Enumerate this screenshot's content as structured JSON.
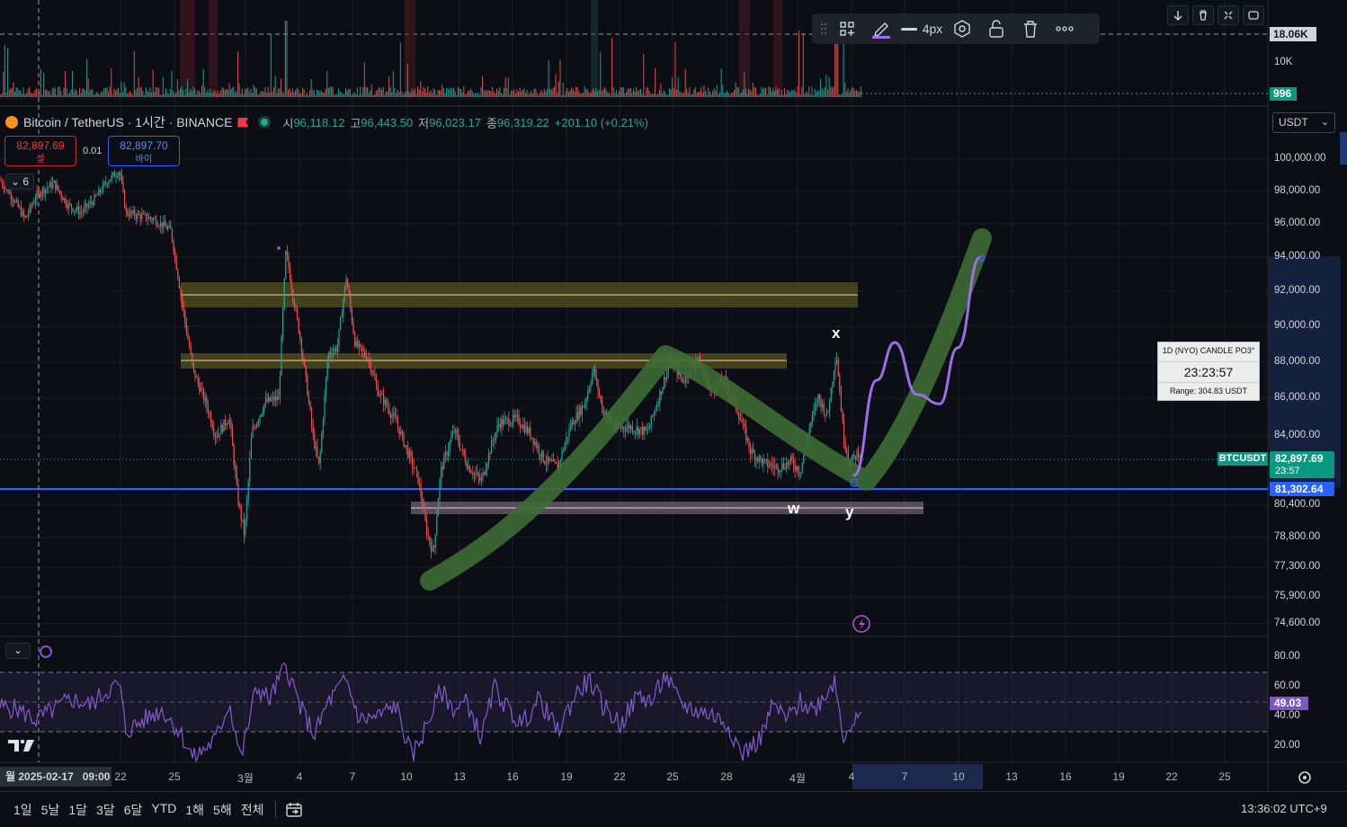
{
  "chart_title": {
    "symbol": "Bitcoin / TetherUS · 1시간 · BINANCE",
    "open_label": "시",
    "open": "96,118.12",
    "high_label": "고",
    "high": "96,443.50",
    "low_label": "저",
    "low": "96,023.17",
    "close_label": "종",
    "close": "96,319.22",
    "change": "+201.10 (+0.21%)"
  },
  "trade": {
    "sell_price": "82,897.69",
    "sell_label": "셀",
    "buy_price": "82,897.70",
    "buy_label": "바이",
    "lot": "0.01"
  },
  "collapse_count": "6",
  "toolbar": {
    "width_label": "4px"
  },
  "currency": "USDT",
  "price_axis": [
    "100,000.00",
    "98,000.00",
    "96,000.00",
    "94,000.00",
    "92,000.00",
    "90,000.00",
    "88,000.00",
    "86,000.00",
    "84,000.00",
    "80,400.00",
    "78,800.00",
    "77,300.00",
    "75,900.00",
    "74,600.00"
  ],
  "volume_axis": {
    "top": "18.06K",
    "mid": "10K",
    "current": "996"
  },
  "rsi_axis": [
    "80.00",
    "60.00",
    "40.00",
    "20.00"
  ],
  "rsi_current": "49.03",
  "tags": {
    "symbol": "BTCUSDT",
    "last_price": "82,897.69",
    "countdown": "23:57",
    "hline_price": "81,302.64"
  },
  "timer_widget": {
    "title": "1D (NYO) CANDLE PO3°",
    "time": "23:23:57",
    "range": "Range: 304.83 USDT"
  },
  "wave_labels": {
    "x": "x",
    "w": "w",
    "y": "y"
  },
  "x_axis": {
    "cursor_label": "월 2025-02-17   09:00",
    "labels": [
      "22",
      "25",
      "3월",
      "4",
      "7",
      "10",
      "13",
      "16",
      "19",
      "22",
      "25",
      "28",
      "4월",
      "4",
      "7",
      "10",
      "13",
      "16",
      "19",
      "22",
      "25"
    ]
  },
  "range_buttons": [
    "1일",
    "5날",
    "1달",
    "3달",
    "6달",
    "YTD",
    "1해",
    "5해",
    "전체"
  ],
  "clock": "13:36:02 UTC+9",
  "colors": {
    "bg": "#0c0e15",
    "up": "#26a69a",
    "down": "#ef5350",
    "hline": "#2962ff",
    "green_path": "#3e6b35",
    "purple": "#9c6fe4",
    "rsi": "#7e57c2"
  },
  "chart_data": {
    "type": "candlestick",
    "interval": "1시간",
    "ylim": [
      73800,
      101500
    ],
    "key_prices": {
      "hline": 81302.64,
      "resistance_zone_1": [
        91300,
        92600
      ],
      "resistance_zone_2": [
        87900,
        88600
      ],
      "support_zone": [
        80200,
        80700
      ],
      "last": 82897.69
    },
    "close_path": [
      [
        0,
        98700
      ],
      [
        12,
        97800
      ],
      [
        28,
        96300
      ],
      [
        40,
        97700
      ],
      [
        45,
        98000
      ],
      [
        60,
        98500
      ],
      [
        75,
        97200
      ],
      [
        90,
        96700
      ],
      [
        105,
        97500
      ],
      [
        120,
        98700
      ],
      [
        133,
        99300
      ],
      [
        140,
        96700
      ],
      [
        155,
        96500
      ],
      [
        170,
        96300
      ],
      [
        190,
        95600
      ],
      [
        205,
        90500
      ],
      [
        215,
        87500
      ],
      [
        230,
        85600
      ],
      [
        240,
        84000
      ],
      [
        255,
        85000
      ],
      [
        265,
        80600
      ],
      [
        272,
        78900
      ],
      [
        280,
        84200
      ],
      [
        295,
        85800
      ],
      [
        310,
        86000
      ],
      [
        318,
        94400
      ],
      [
        325,
        92000
      ],
      [
        335,
        89000
      ],
      [
        348,
        84000
      ],
      [
        355,
        82400
      ],
      [
        365,
        88500
      ],
      [
        375,
        88800
      ],
      [
        385,
        92800
      ],
      [
        395,
        89000
      ],
      [
        410,
        88200
      ],
      [
        420,
        86400
      ],
      [
        440,
        84800
      ],
      [
        455,
        83000
      ],
      [
        465,
        81800
      ],
      [
        475,
        79000
      ],
      [
        482,
        78000
      ],
      [
        490,
        82200
      ],
      [
        505,
        84300
      ],
      [
        520,
        82500
      ],
      [
        535,
        81700
      ],
      [
        545,
        83300
      ],
      [
        555,
        84700
      ],
      [
        575,
        84900
      ],
      [
        590,
        84100
      ],
      [
        605,
        82800
      ],
      [
        620,
        82400
      ],
      [
        635,
        84600
      ],
      [
        650,
        85700
      ],
      [
        660,
        87600
      ],
      [
        670,
        85400
      ],
      [
        685,
        84400
      ],
      [
        700,
        84500
      ],
      [
        720,
        84200
      ],
      [
        735,
        86400
      ],
      [
        745,
        88100
      ],
      [
        760,
        87000
      ],
      [
        775,
        88300
      ],
      [
        790,
        86400
      ],
      [
        805,
        87000
      ],
      [
        820,
        85400
      ],
      [
        835,
        83200
      ],
      [
        850,
        82600
      ],
      [
        865,
        82400
      ],
      [
        880,
        82700
      ],
      [
        890,
        82200
      ],
      [
        900,
        84400
      ],
      [
        910,
        86100
      ],
      [
        920,
        85000
      ],
      [
        930,
        88600
      ],
      [
        938,
        84000
      ],
      [
        945,
        82600
      ],
      [
        955,
        83200
      ],
      [
        958,
        82900
      ]
    ],
    "projection": [
      [
        950,
        82000
      ],
      [
        975,
        87000
      ],
      [
        995,
        89100
      ],
      [
        1020,
        86200
      ],
      [
        1045,
        85700
      ],
      [
        1065,
        88800
      ],
      [
        1090,
        94000
      ]
    ],
    "rsi_path": [
      [
        0,
        57
      ],
      [
        20,
        55
      ],
      [
        40,
        48
      ],
      [
        60,
        55
      ],
      [
        80,
        62
      ],
      [
        100,
        58
      ],
      [
        120,
        68
      ],
      [
        133,
        72
      ],
      [
        140,
        40
      ],
      [
        160,
        48
      ],
      [
        180,
        55
      ],
      [
        200,
        40
      ],
      [
        215,
        22
      ],
      [
        240,
        35
      ],
      [
        255,
        60
      ],
      [
        268,
        22
      ],
      [
        285,
        70
      ],
      [
        300,
        62
      ],
      [
        318,
        85
      ],
      [
        335,
        55
      ],
      [
        350,
        38
      ],
      [
        365,
        60
      ],
      [
        385,
        75
      ],
      [
        400,
        48
      ],
      [
        420,
        50
      ],
      [
        440,
        58
      ],
      [
        458,
        23
      ],
      [
        475,
        45
      ],
      [
        490,
        68
      ],
      [
        505,
        55
      ],
      [
        520,
        60
      ],
      [
        535,
        35
      ],
      [
        550,
        70
      ],
      [
        565,
        55
      ],
      [
        580,
        45
      ],
      [
        600,
        62
      ],
      [
        620,
        40
      ],
      [
        640,
        65
      ],
      [
        655,
        75
      ],
      [
        670,
        58
      ],
      [
        690,
        45
      ],
      [
        710,
        65
      ],
      [
        725,
        60
      ],
      [
        740,
        78
      ],
      [
        755,
        60
      ],
      [
        770,
        55
      ],
      [
        790,
        52
      ],
      [
        810,
        45
      ],
      [
        825,
        25
      ],
      [
        845,
        35
      ],
      [
        860,
        58
      ],
      [
        875,
        48
      ],
      [
        890,
        60
      ],
      [
        905,
        55
      ],
      [
        915,
        63
      ],
      [
        928,
        75
      ],
      [
        938,
        38
      ],
      [
        945,
        45
      ],
      [
        958,
        49
      ]
    ]
  }
}
